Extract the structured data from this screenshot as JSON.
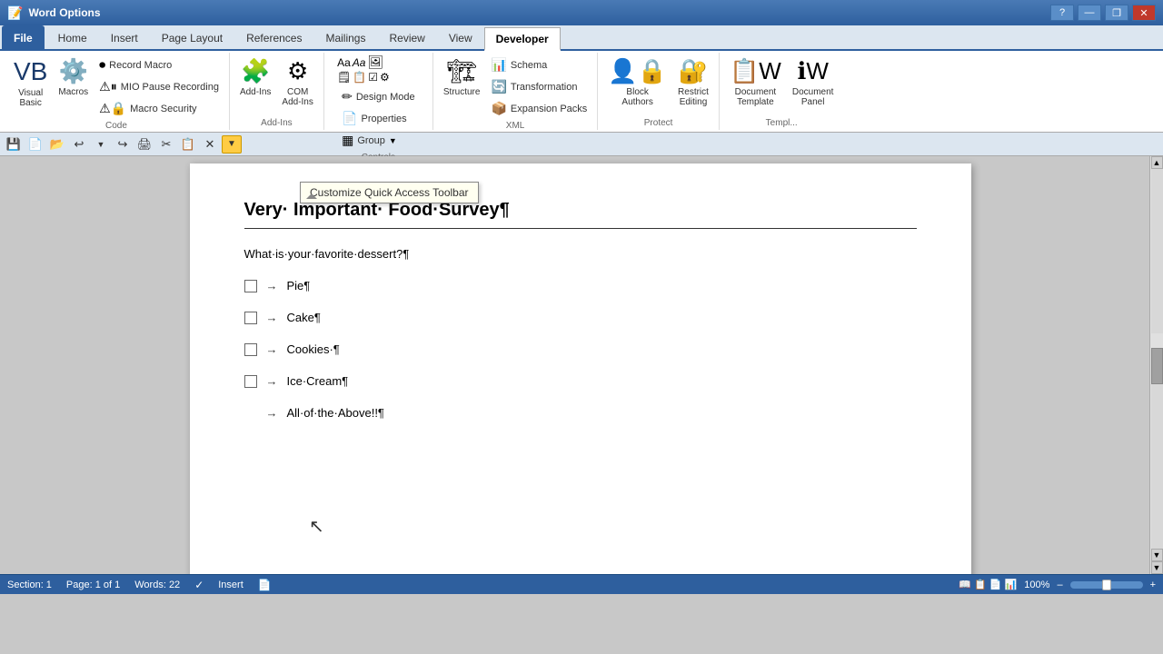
{
  "titleBar": {
    "title": "Word Options",
    "helpBtn": "?",
    "closeBtn": "✕",
    "minBtn": "—",
    "restoreBtn": "❐"
  },
  "tabs": {
    "items": [
      "File",
      "Home",
      "Insert",
      "Page Layout",
      "References",
      "Mailings",
      "Review",
      "View",
      "Developer"
    ]
  },
  "ribbon": {
    "code": {
      "label": "Code",
      "visualBasic": "Visual\nBasic",
      "macros": "Macros",
      "recordMacro": "Record Macro",
      "pauseRecording": "MIO Pause Recording",
      "macroSecurity": "Macro Security"
    },
    "addIns": {
      "label": "Add-Ins",
      "addIns": "Add-Ins",
      "comAddIns": "COM\nAdd-Ins"
    },
    "controls": {
      "label": "Controls",
      "designMode": "Design Mode",
      "properties": "Properties",
      "group": "Group"
    },
    "xml": {
      "label": "XML",
      "structure": "Structure",
      "schema": "Schema",
      "transformation": "Transformation",
      "expansionPacks": "Expansion Packs"
    },
    "protect": {
      "label": "Protect",
      "blockAuthors": "Block Authors",
      "restrictEditing": "Restrict Editing"
    },
    "templates": {
      "label": "Templates",
      "documentTemplate": "Document\nTemplate",
      "documentPanel": "Document\nPanel"
    }
  },
  "quickAccess": {
    "buttons": [
      "💾",
      "📄",
      "📂",
      "↩",
      "↪",
      "🖨",
      "✂",
      "📋",
      "✕",
      "▼"
    ]
  },
  "tooltip": {
    "text": "Customize Quick Access Toolbar"
  },
  "document": {
    "title": "Very· Important· Food·Survey¶",
    "question": "What·is·your·favorite·dessert?¶",
    "items": [
      {
        "hasCheckbox": true,
        "text": "Pie¶"
      },
      {
        "hasCheckbox": true,
        "text": "Cake¶"
      },
      {
        "hasCheckbox": true,
        "text": "Cookies·¶"
      },
      {
        "hasCheckbox": true,
        "text": "Ice·Cream¶"
      }
    ],
    "lastItem": "All·of·the·Above!!¶"
  },
  "statusBar": {
    "section": "Section: 1",
    "page": "Page: 1 of 1",
    "words": "Words: 22",
    "mode": "Insert",
    "zoom": "100%"
  }
}
